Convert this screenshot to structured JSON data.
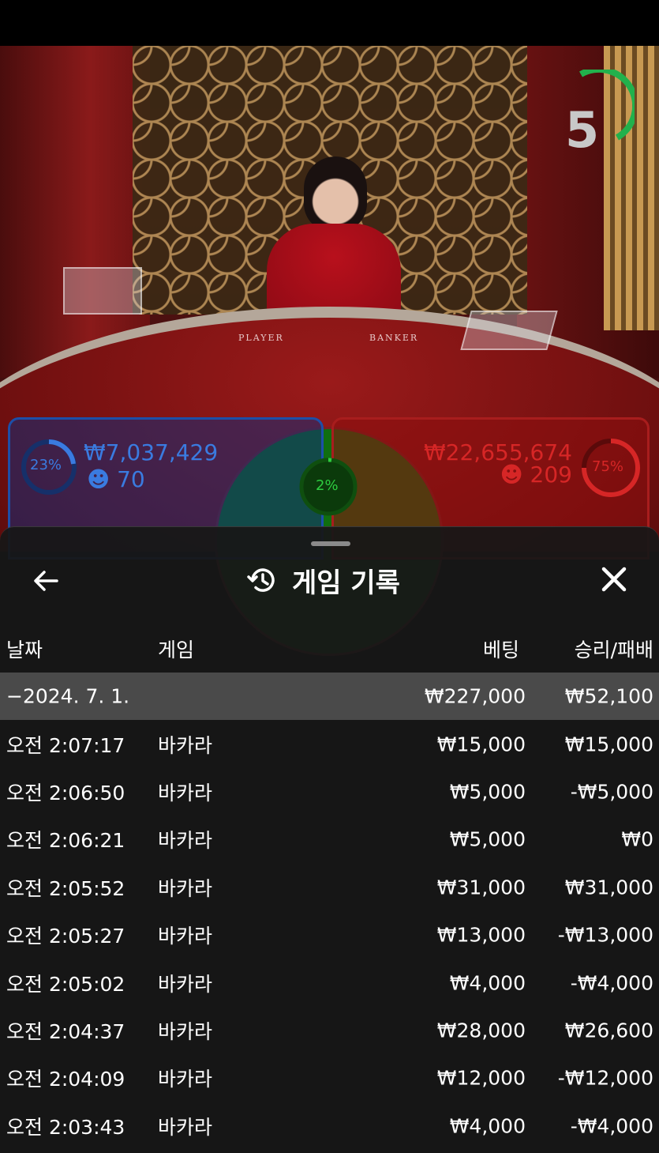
{
  "stream": {
    "timer": "5",
    "table_labels": {
      "player": "PLAYER",
      "banker": "BANKER"
    }
  },
  "bets": {
    "player": {
      "percent": "23%",
      "amount": "₩7,037,429",
      "count": "70"
    },
    "banker": {
      "percent": "75%",
      "amount": "₩22,655,674",
      "count": "209"
    },
    "tie": {
      "percent": "2%"
    }
  },
  "colors": {
    "player": "#3a7be0",
    "banker": "#d62626",
    "tie": "#2ecc40",
    "timer": "#22b14c"
  },
  "history": {
    "title": "게임 기록",
    "icons": {
      "back": "arrow-left-icon",
      "history": "history-icon",
      "close": "close-icon"
    },
    "columns": {
      "date": "날짜",
      "game": "게임",
      "bet": "베팅",
      "result": "승리/패배"
    },
    "summary": {
      "date": "−2024. 7. 1.",
      "bet": "₩227,000",
      "result": "₩52,100"
    },
    "rows": [
      {
        "time": "오전 2:07:17",
        "game": "바카라",
        "bet": "₩15,000",
        "result": "₩15,000"
      },
      {
        "time": "오전 2:06:50",
        "game": "바카라",
        "bet": "₩5,000",
        "result": "-₩5,000"
      },
      {
        "time": "오전 2:06:21",
        "game": "바카라",
        "bet": "₩5,000",
        "result": "₩0"
      },
      {
        "time": "오전 2:05:52",
        "game": "바카라",
        "bet": "₩31,000",
        "result": "₩31,000"
      },
      {
        "time": "오전 2:05:27",
        "game": "바카라",
        "bet": "₩13,000",
        "result": "-₩13,000"
      },
      {
        "time": "오전 2:05:02",
        "game": "바카라",
        "bet": "₩4,000",
        "result": "-₩4,000"
      },
      {
        "time": "오전 2:04:37",
        "game": "바카라",
        "bet": "₩28,000",
        "result": "₩26,600"
      },
      {
        "time": "오전 2:04:09",
        "game": "바카라",
        "bet": "₩12,000",
        "result": "-₩12,000"
      },
      {
        "time": "오전 2:03:43",
        "game": "바카라",
        "bet": "₩4,000",
        "result": "-₩4,000"
      }
    ]
  }
}
